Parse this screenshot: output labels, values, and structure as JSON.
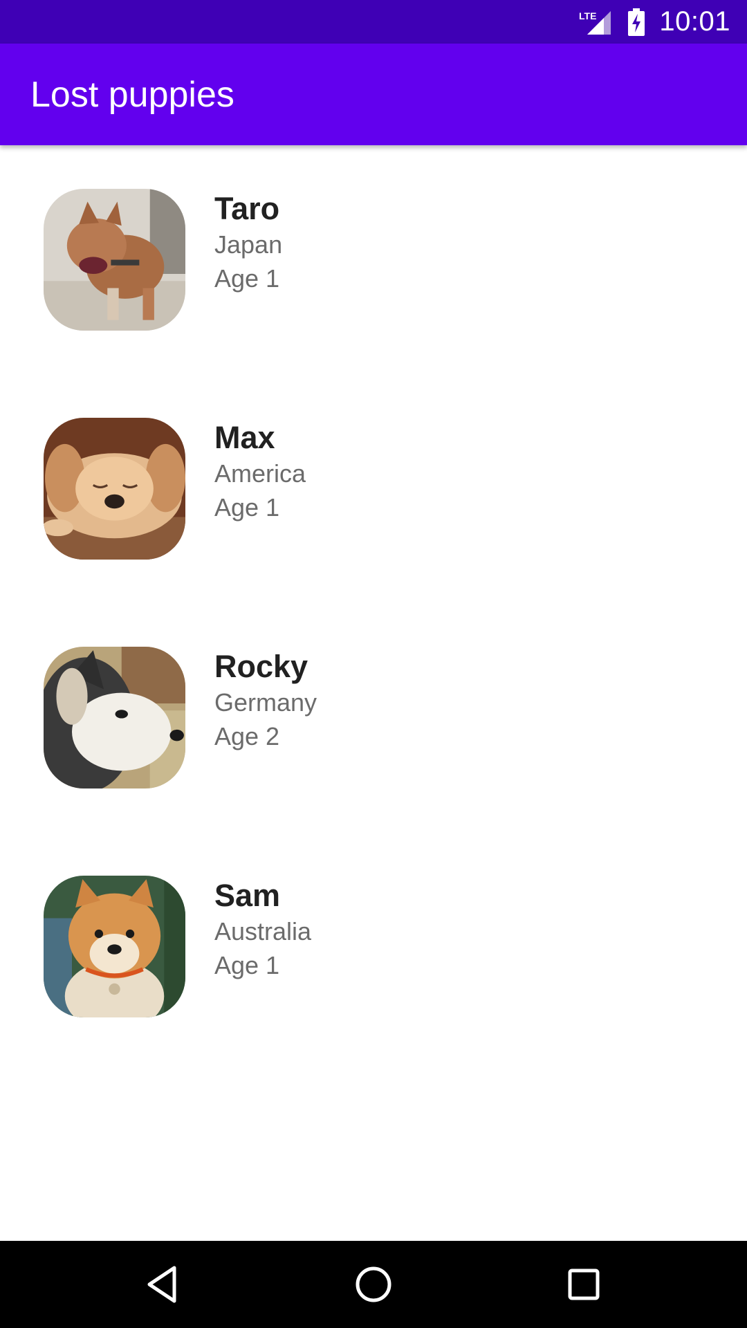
{
  "status_bar": {
    "network": "LTE",
    "time": "10:01",
    "icons": [
      "lte-signal-icon",
      "battery-charging-icon"
    ]
  },
  "app_bar": {
    "title": "Lost puppies"
  },
  "puppies": [
    {
      "name": "Taro",
      "country": "Japan",
      "age": "Age 1",
      "photo": "puppy-photo-taro"
    },
    {
      "name": "Max",
      "country": "America",
      "age": "Age 1",
      "photo": "puppy-photo-max"
    },
    {
      "name": "Rocky",
      "country": "Germany",
      "age": "Age 2",
      "photo": "puppy-photo-rocky"
    },
    {
      "name": "Sam",
      "country": "Australia",
      "age": "Age 1",
      "photo": "puppy-photo-sam"
    }
  ],
  "nav_bar": {
    "buttons": [
      "back-icon",
      "home-icon",
      "recents-icon"
    ]
  },
  "colors": {
    "status_bar": "#3f00b5",
    "app_bar": "#6200ee",
    "nav_bar": "#000000",
    "name_text": "#212121",
    "secondary_text": "#6b6b6b"
  }
}
